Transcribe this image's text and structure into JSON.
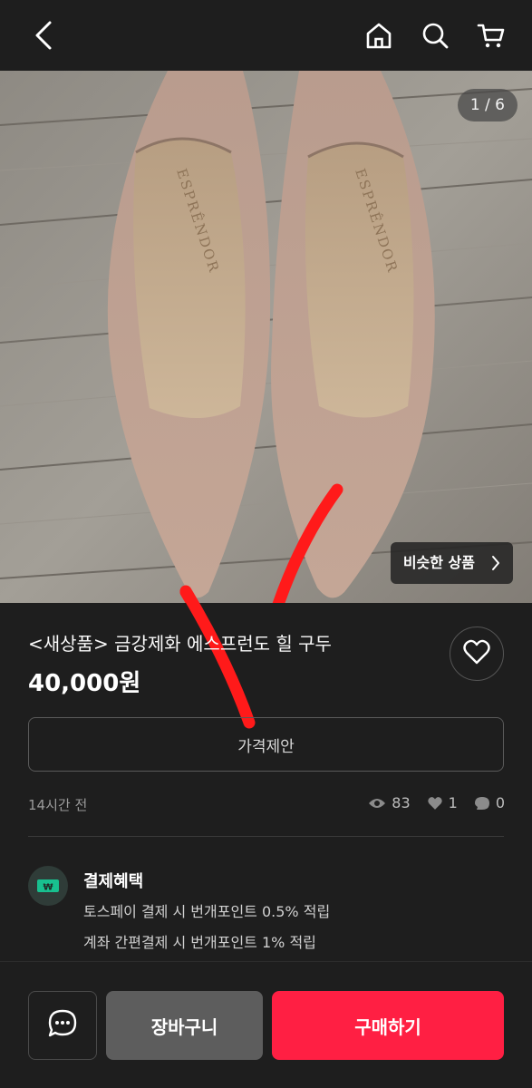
{
  "header": {
    "icons": [
      "back-icon",
      "home-icon",
      "search-icon",
      "cart-icon"
    ]
  },
  "gallery": {
    "counter": "1 / 6",
    "similar_label": "비슷한 상품",
    "brand_text": "ESPRÊNDOR"
  },
  "product": {
    "title": "<새상품> 금강제화 에스프런도 힐 구두",
    "price": "40,000원",
    "offer_label": "가격제안",
    "posted": "14시간 전",
    "views": "83",
    "likes": "1",
    "chats": "0"
  },
  "benefit": {
    "title": "결제혜택",
    "line1": "토스페이 결제 시 번개포인트 0.5% 적립",
    "line2": "계좌 간편결제 시 번개포인트 1% 적립"
  },
  "actions": {
    "cart_label": "장바구니",
    "buy_label": "구매하기"
  },
  "colors": {
    "background": "#1e1e1e",
    "buy_button": "#ff1f43",
    "cart_button": "#5d5d5d",
    "check_mark": "#ff1a1a"
  }
}
